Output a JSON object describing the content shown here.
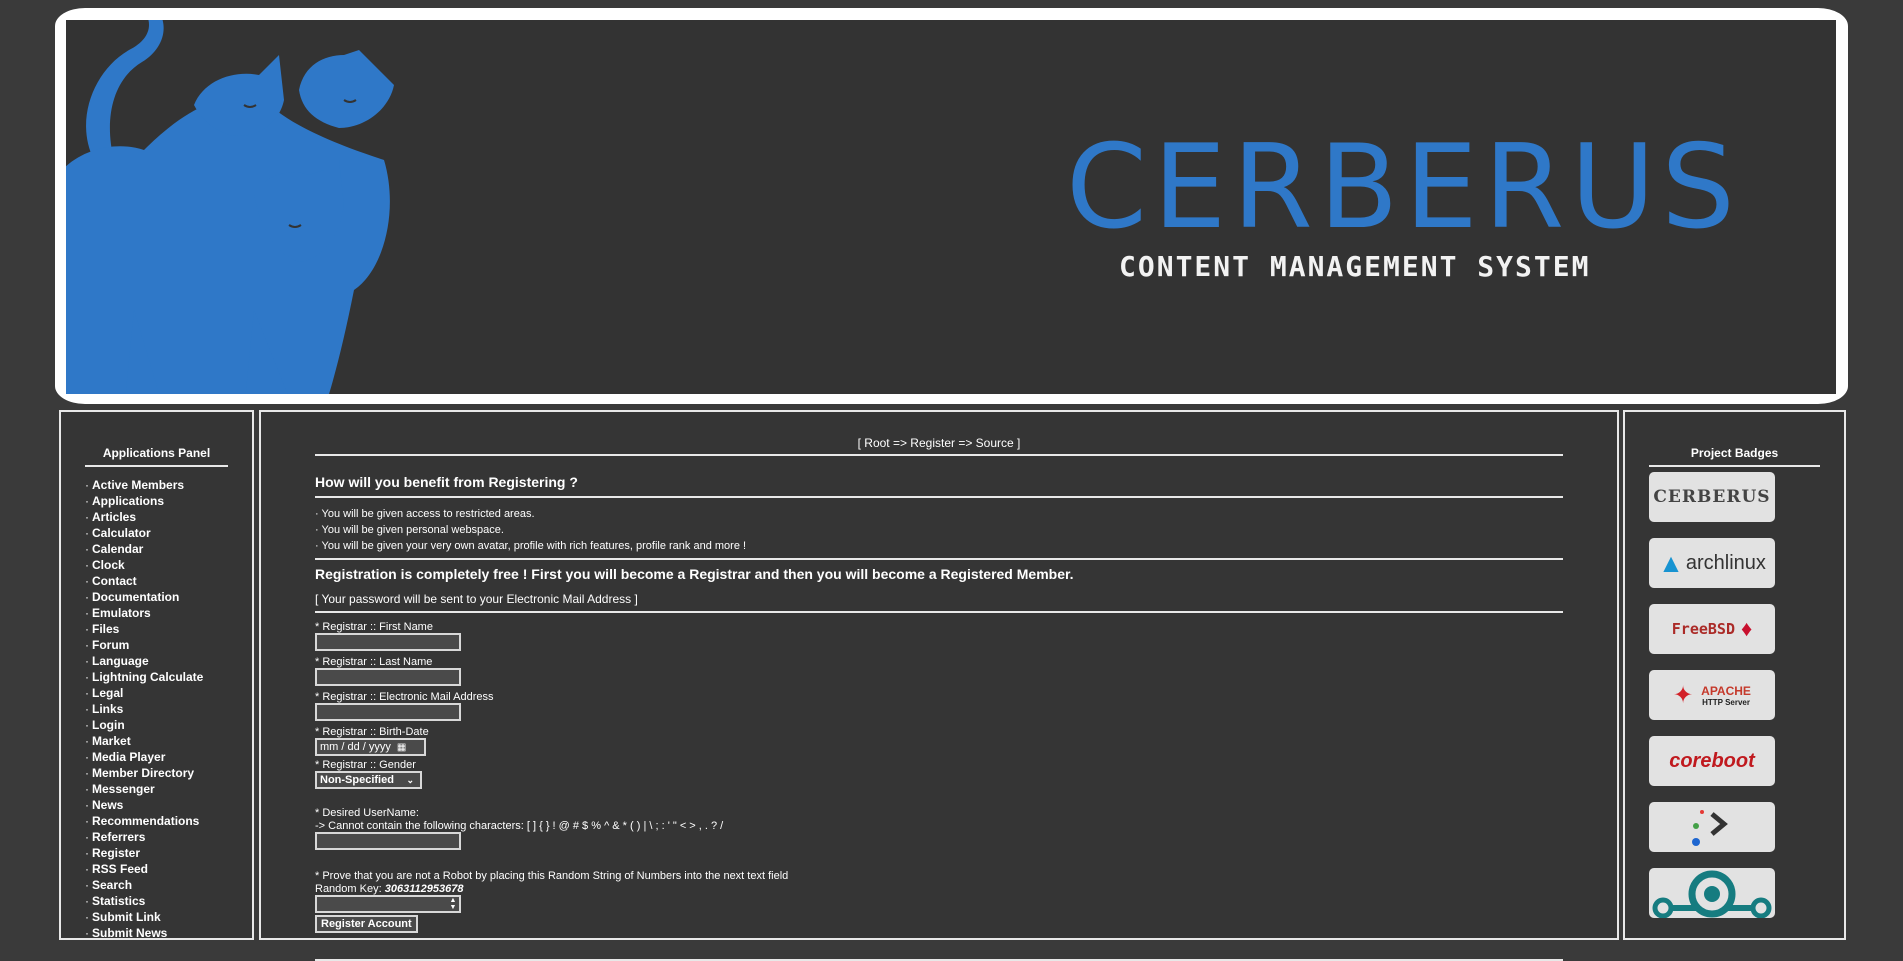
{
  "banner": {
    "brand_title": "CERBERUS",
    "brand_subtitle": "CONTENT MANAGEMENT SYSTEM",
    "brand_color": "#2f78c8"
  },
  "left_panel": {
    "title": "Applications Panel",
    "items": [
      "Active Members",
      "Applications",
      "Articles",
      "Calculator",
      "Calendar",
      "Clock",
      "Contact",
      "Documentation",
      "Emulators",
      "Files",
      "Forum",
      "Language",
      "Lightning Calculate",
      "Legal",
      "Links",
      "Login",
      "Market",
      "Media Player",
      "Member Directory",
      "Messenger",
      "News",
      "Recommendations",
      "Referrers",
      "Register",
      "RSS Feed",
      "Search",
      "Statistics",
      "Submit Link",
      "Submit News"
    ]
  },
  "main": {
    "breadcrumb": "[ Root => Register => Source ]",
    "benefit_heading": "How will you benefit from Registering ?",
    "benefits": [
      "You will be given access to restricted areas.",
      "You will be given personal webspace.",
      "You will be given your very own avatar, profile with rich features, profile rank and more !"
    ],
    "free_note": "Registration is completely free ! First you will become a Registrar and then you will become a Registered Member.",
    "password_note": "[ Your password will be sent to your Electronic Mail Address ]",
    "labels": {
      "first_name": "* Registrar :: First Name",
      "last_name": "* Registrar :: Last Name",
      "email": "* Registrar :: Electronic Mail Address",
      "birth_date": "* Registrar :: Birth-Date",
      "gender": "* Registrar :: Gender",
      "username": "* Desired UserName:",
      "username_rule": "-> Cannot contain the following characters: [ ] { } ! @ # $ % ^ & * ( ) | \\ ; : ' \" < > , . ? /",
      "robot": "* Prove that you are not a Robot by placing this Random String of Numbers into the next text field",
      "random_key_label": "Random Key:"
    },
    "birth_date_placeholder": "mm / dd / yyyy",
    "gender_selected": "Non-Specified",
    "random_key": "3063112953678",
    "submit_label": "Register Account"
  },
  "right_panel": {
    "title": "Project Badges",
    "badges": [
      {
        "name": "cerberus",
        "label": "CERBERUS"
      },
      {
        "name": "archlinux",
        "label": "archlinux"
      },
      {
        "name": "freebsd",
        "label": "FreeBSD"
      },
      {
        "name": "apache",
        "label": "APACHE",
        "sub": "HTTP Server"
      },
      {
        "name": "coreboot",
        "label": "coreboot"
      },
      {
        "name": "terminal",
        "label": ""
      },
      {
        "name": "lineage",
        "label": ""
      }
    ]
  }
}
